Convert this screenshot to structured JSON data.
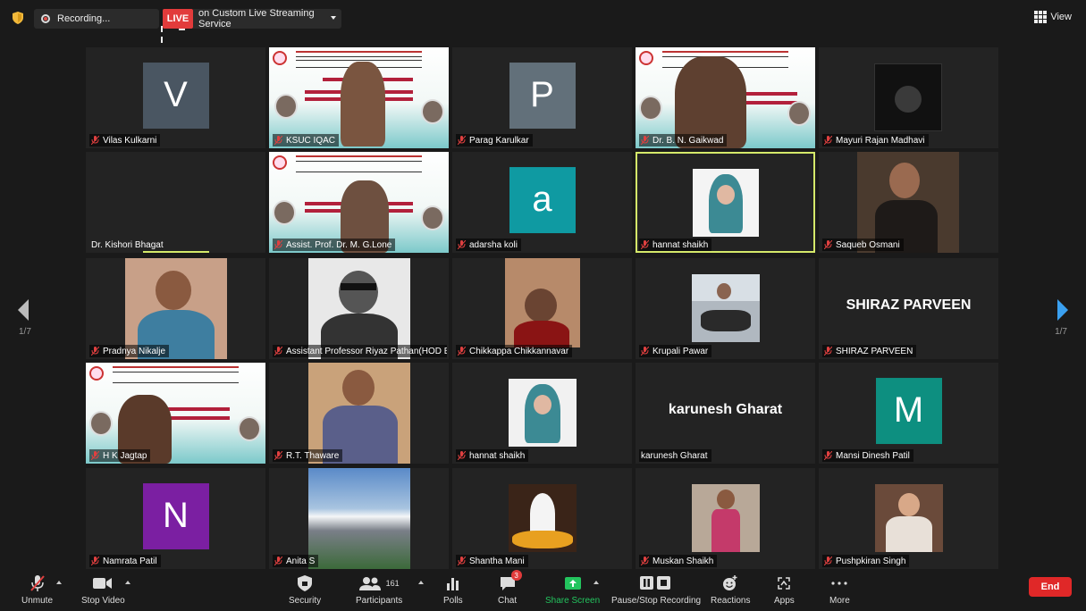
{
  "topbar": {
    "recording_label": "Recording...",
    "live_label": "LIVE",
    "stream_label": "on Custom Live Streaming Service",
    "view_label": "View"
  },
  "nav": {
    "page_left": "1/7",
    "page_right": "1/7"
  },
  "tiles": [
    {
      "name": "Vilas Kulkarni",
      "avatar_letter": "V",
      "avatar_color": "#4a5662"
    },
    {
      "name": "KSUC IQAC",
      "type": "poster"
    },
    {
      "name": "Parag Karulkar",
      "avatar_letter": "P",
      "avatar_color": "#62707a"
    },
    {
      "name": "Dr. B. N. Gaikwad",
      "type": "poster"
    },
    {
      "name": "Mayuri Rajan Madhavi",
      "type": "photo"
    },
    {
      "name": "Dr. Kishori Bhagat",
      "type": "blank"
    },
    {
      "name": "Assist. Prof. Dr. M. G.Lone",
      "type": "poster"
    },
    {
      "name": "adarsha koli",
      "avatar_letter": "a",
      "avatar_color": "#0f9aa2"
    },
    {
      "name": "hannat shaikh",
      "type": "photo",
      "active": true
    },
    {
      "name": "Saqueb Osmani",
      "type": "photo"
    },
    {
      "name": "Pradnya Nikalje",
      "type": "photo"
    },
    {
      "name": "Assistant Professor Riyaz Pathan(HOD B...",
      "type": "photo"
    },
    {
      "name": "Chikkappa Chikkannavar",
      "type": "photo"
    },
    {
      "name": "Krupali Pawar",
      "type": "photo"
    },
    {
      "name": "SHIRAZ PARVEEN",
      "big_name": "SHIRAZ PARVEEN"
    },
    {
      "name": "H K Jagtap",
      "type": "poster"
    },
    {
      "name": "R.T. Thaware",
      "type": "photo"
    },
    {
      "name": "hannat shaikh",
      "type": "photo"
    },
    {
      "name": "karunesh Gharat",
      "big_name": "karunesh Gharat",
      "no_mic": true
    },
    {
      "name": "Mansi Dinesh Patil",
      "avatar_letter": "M",
      "avatar_color": "#0d8f80"
    },
    {
      "name": "Namrata Patil",
      "avatar_letter": "N",
      "avatar_color": "#7b1fa2"
    },
    {
      "name": "Anita S",
      "type": "photo"
    },
    {
      "name": "Shantha Mani",
      "type": "photo"
    },
    {
      "name": "Muskan Shaikh",
      "type": "photo"
    },
    {
      "name": "Pushpkiran Singh",
      "type": "photo"
    }
  ],
  "poster_text": {
    "org": "KONKAN GYANPEETH",
    "college": "URAN COLLEGE OF COMMERCE & ARTS, URAN, RAIGAD",
    "dept": "DEPARTMENT OF ACCOUNTING & FINANCE",
    "title": "\"Service Sector: Challenges, Prospects During Covid 19 Pandemic\"",
    "chief_guest": "Chief Guest",
    "guest_honour": "Guest of Honour"
  },
  "toolbar": {
    "unmute": "Unmute",
    "stop_video": "Stop Video",
    "security": "Security",
    "participants": "Participants",
    "participants_count": "161",
    "polls": "Polls",
    "chat": "Chat",
    "chat_badge": "3",
    "share_screen": "Share Screen",
    "recording": "Pause/Stop Recording",
    "reactions": "Reactions",
    "apps": "Apps",
    "more": "More",
    "end": "End"
  },
  "colors": {
    "active_border": "#d5e96a",
    "share_green": "#23c45e",
    "end_red": "#e02828",
    "live_red": "#e23b3b"
  }
}
